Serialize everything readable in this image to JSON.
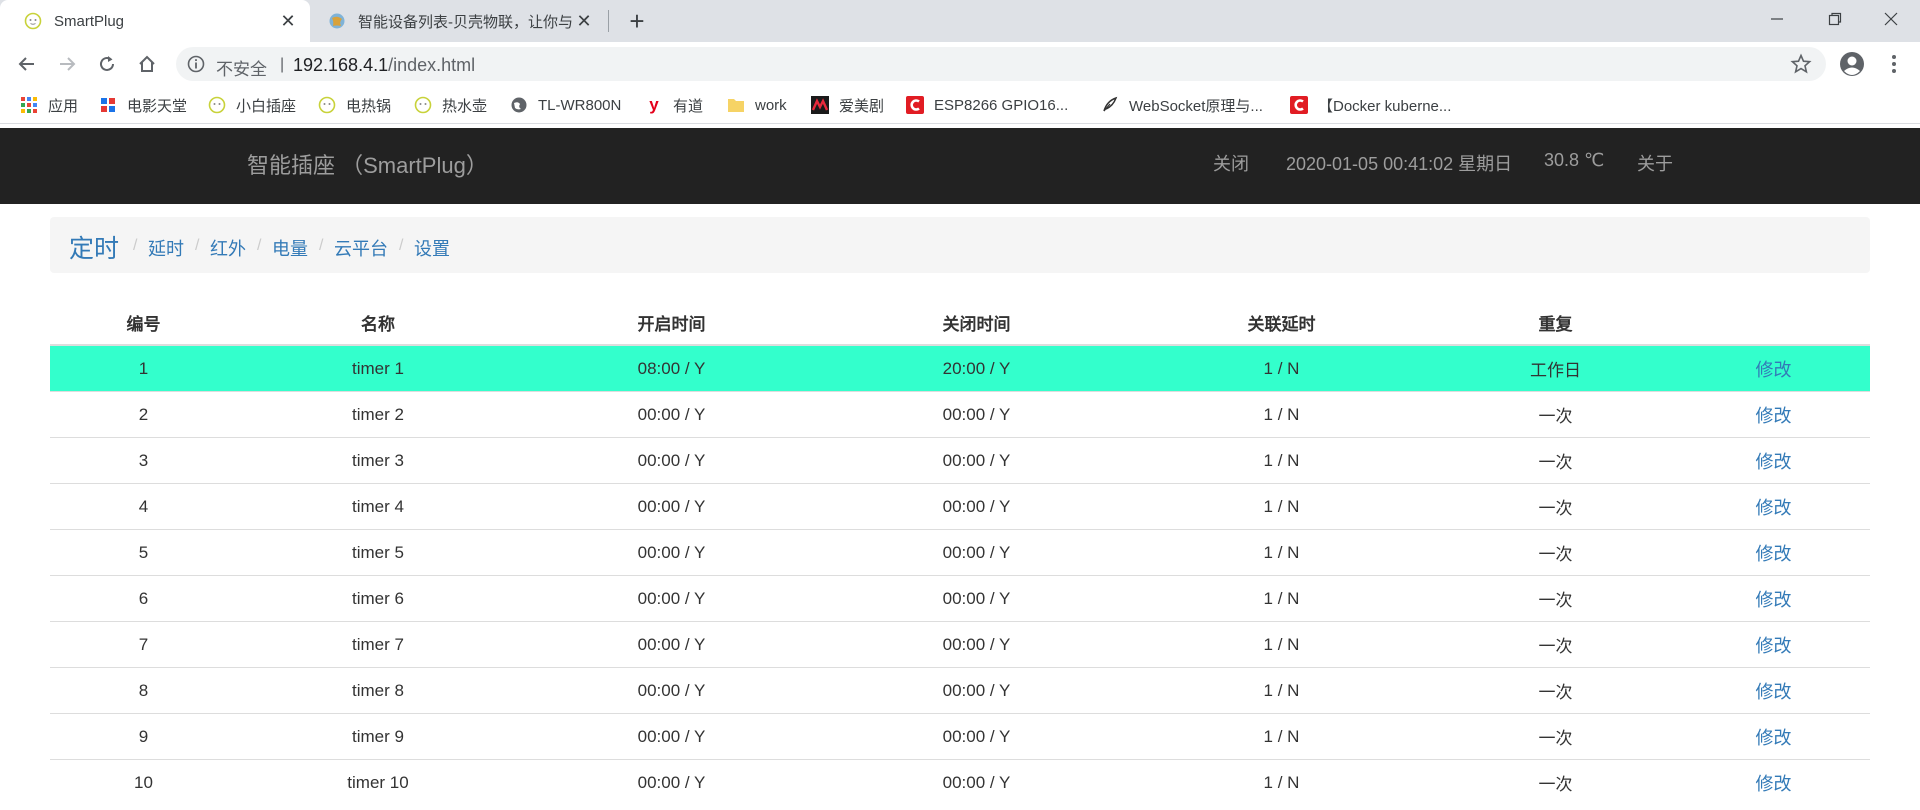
{
  "browser": {
    "tabs": [
      {
        "title": "SmartPlug",
        "active": true,
        "favicon": "plug-icon"
      },
      {
        "title": "智能设备列表-贝壳物联，让你与",
        "active": false,
        "favicon": "globe-icon"
      }
    ],
    "address": {
      "security_label": "不安全",
      "separator": "|",
      "host": "192.168.4.1",
      "path": "/index.html"
    },
    "bookmarks": [
      {
        "label": "应用",
        "icon": "apps-grid-icon"
      },
      {
        "label": "电影天堂",
        "icon": "film-icon"
      },
      {
        "label": "小白插座",
        "icon": "plug-icon"
      },
      {
        "label": "电热锅",
        "icon": "plug-icon"
      },
      {
        "label": "热水壶",
        "icon": "plug-icon"
      },
      {
        "label": "TL-WR800N",
        "icon": "globe-icon"
      },
      {
        "label": "有道",
        "icon": "youdao-icon"
      },
      {
        "label": "work",
        "icon": "folder-icon"
      },
      {
        "label": "爱美剧",
        "icon": "drama-icon"
      },
      {
        "label": "ESP8266 GPIO16...",
        "icon": "csdn-icon"
      },
      {
        "label": "WebSocket原理与...",
        "icon": "feather-icon"
      },
      {
        "label": "【Docker kuberne...",
        "icon": "csdn-icon"
      }
    ]
  },
  "navbar": {
    "brand": "智能插座 （SmartPlug）",
    "power_status": "关闭",
    "datetime": "2020-01-05 00:41:02 星期日",
    "temperature": "30.8 ℃",
    "about": "关于"
  },
  "breadcrumb": {
    "current": "定时",
    "links": [
      "延时",
      "红外",
      "电量",
      "云平台",
      "设置"
    ],
    "separator": "/"
  },
  "table": {
    "headers": [
      "编号",
      "名称",
      "开启时间",
      "关闭时间",
      "关联延时",
      "重复",
      ""
    ],
    "edit_label": "修改",
    "rows": [
      {
        "id": "1",
        "name": "timer 1",
        "on": "08:00 / Y",
        "off": "20:00 / Y",
        "delay": "1 / N",
        "repeat": "工作日",
        "highlight": true
      },
      {
        "id": "2",
        "name": "timer 2",
        "on": "00:00 / Y",
        "off": "00:00 / Y",
        "delay": "1 / N",
        "repeat": "一次"
      },
      {
        "id": "3",
        "name": "timer 3",
        "on": "00:00 / Y",
        "off": "00:00 / Y",
        "delay": "1 / N",
        "repeat": "一次"
      },
      {
        "id": "4",
        "name": "timer 4",
        "on": "00:00 / Y",
        "off": "00:00 / Y",
        "delay": "1 / N",
        "repeat": "一次"
      },
      {
        "id": "5",
        "name": "timer 5",
        "on": "00:00 / Y",
        "off": "00:00 / Y",
        "delay": "1 / N",
        "repeat": "一次"
      },
      {
        "id": "6",
        "name": "timer 6",
        "on": "00:00 / Y",
        "off": "00:00 / Y",
        "delay": "1 / N",
        "repeat": "一次"
      },
      {
        "id": "7",
        "name": "timer 7",
        "on": "00:00 / Y",
        "off": "00:00 / Y",
        "delay": "1 / N",
        "repeat": "一次"
      },
      {
        "id": "8",
        "name": "timer 8",
        "on": "00:00 / Y",
        "off": "00:00 / Y",
        "delay": "1 / N",
        "repeat": "一次"
      },
      {
        "id": "9",
        "name": "timer 9",
        "on": "00:00 / Y",
        "off": "00:00 / Y",
        "delay": "1 / N",
        "repeat": "一次"
      },
      {
        "id": "10",
        "name": "timer 10",
        "on": "00:00 / Y",
        "off": "00:00 / Y",
        "delay": "1 / N",
        "repeat": "一次"
      }
    ]
  },
  "colors": {
    "navbar_bg": "#222222",
    "link": "#337ab7",
    "row_highlight": "#33ffcc"
  }
}
